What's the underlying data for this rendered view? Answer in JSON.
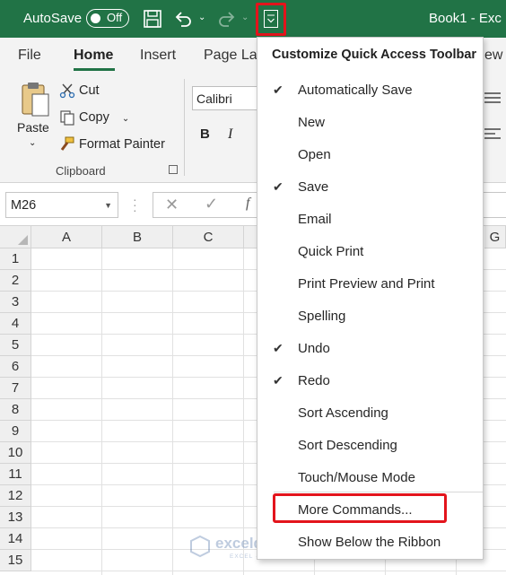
{
  "titlebar": {
    "autosave_label": "AutoSave",
    "autosave_state": "Off",
    "window_title": "Book1  -  Exc"
  },
  "ribbon_tabs": [
    "File",
    "Home",
    "Insert",
    "Page La",
    "ew"
  ],
  "clipboard": {
    "paste": "Paste",
    "cut": "Cut",
    "copy": "Copy",
    "format_painter": "Format Painter",
    "group_label": "Clipboard"
  },
  "font": {
    "name": "Calibri",
    "bold": "B",
    "italic": "I"
  },
  "formula_bar": {
    "name_box": "M26",
    "cancel": "✕",
    "enter": "✓",
    "fx": "f"
  },
  "grid": {
    "columns": [
      "A",
      "B",
      "C",
      "G"
    ],
    "rows": [
      "1",
      "2",
      "3",
      "4",
      "5",
      "6",
      "7",
      "8",
      "9",
      "10",
      "11",
      "12",
      "13",
      "14",
      "15"
    ]
  },
  "qat_menu": {
    "header": "Customize Quick Access Toolbar",
    "items": [
      {
        "label": "Automatically Save",
        "checked": true
      },
      {
        "label": "New",
        "checked": false
      },
      {
        "label": "Open",
        "checked": false
      },
      {
        "label": "Save",
        "checked": true
      },
      {
        "label": "Email",
        "checked": false
      },
      {
        "label": "Quick Print",
        "checked": false
      },
      {
        "label": "Print Preview and Print",
        "checked": false
      },
      {
        "label": "Spelling",
        "checked": false
      },
      {
        "label": "Undo",
        "checked": true
      },
      {
        "label": "Redo",
        "checked": true
      },
      {
        "label": "Sort Ascending",
        "checked": false
      },
      {
        "label": "Sort Descending",
        "checked": false
      },
      {
        "label": "Touch/Mouse Mode",
        "checked": false
      }
    ],
    "more_commands": "More Commands...",
    "show_below": "Show Below the Ribbon",
    "check_glyph": "✔"
  },
  "watermark": {
    "brand": "exceldemy",
    "tagline": "EXCEL · DATA · BI"
  },
  "colors": {
    "excel_green": "#217346",
    "highlight_red": "#e3141c",
    "ribbon_bg": "#f3f3f3"
  }
}
